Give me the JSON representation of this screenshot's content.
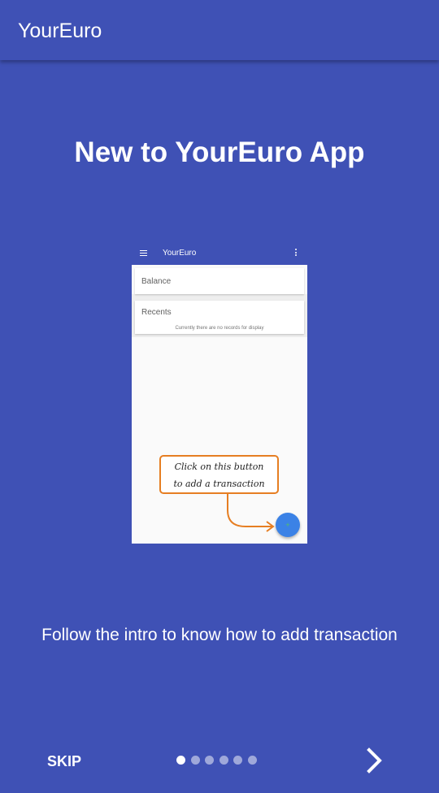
{
  "appbar": {
    "title": "YourEuro"
  },
  "intro": {
    "headline": "New to YourEuro App",
    "subtitle": "Follow the intro to know how to add transaction"
  },
  "screenshot": {
    "app_title": "YourEuro",
    "balance_label": "Balance",
    "recents_label": "Recents",
    "recents_empty": "Currently there are no records for display",
    "fab_label": "+",
    "callout_line1": "Click on this button",
    "callout_line2": "to add a transaction"
  },
  "nav": {
    "skip_label": "SKIP",
    "page_count": 6,
    "current_page": 1,
    "next_icon": "chevron-right-icon"
  },
  "colors": {
    "primary": "#3f51b5",
    "callout_border": "#e67e22",
    "fab": "#3b82e6"
  }
}
